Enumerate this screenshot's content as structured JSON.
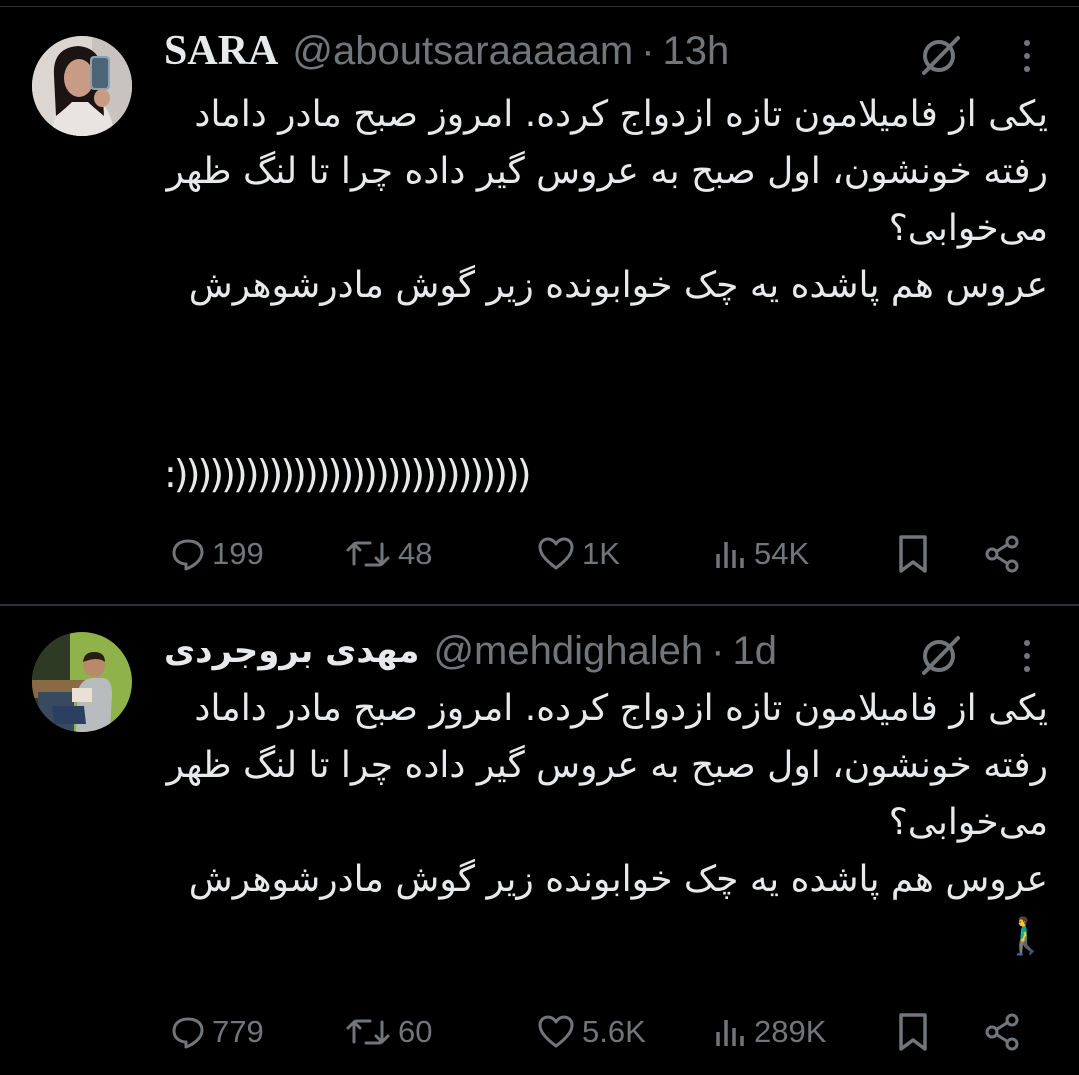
{
  "tweets": [
    {
      "name": "SARA",
      "handle": "@aboutsaraaaaam",
      "dot": "·",
      "time": "13h",
      "text": "یکی از فامیلامون تازه ازدواج کرده. امروز صبح مادر داماد رفته خونشون، اول صبح به عروس گیر داده چرا تا لنگ ظهر می‌خوابی؟\nعروس هم پاشده یه چک خوابونده زیر گوش مادرشوهرش",
      "extra": ":))))))))))))))))))))))))))))))",
      "stats": {
        "replies": "199",
        "reposts": "48",
        "likes": "1K",
        "views": "54K"
      }
    },
    {
      "name": "مهدی بروجردی",
      "handle": "@mehdighaleh",
      "dot": "·",
      "time": "1d",
      "text": "یکی از فامیلامون تازه ازدواج کرده. امروز صبح مادر داماد رفته خونشون، اول صبح به عروس گیر داده چرا تا لنگ ظهر می‌خوابی؟\nعروس هم پاشده یه چک خوابونده زیر گوش مادرشوهرش 🚶‍♂️",
      "stats": {
        "replies": "779",
        "reposts": "60",
        "likes": "5.6K",
        "views": "289K"
      }
    }
  ],
  "colors": {
    "background": "#000000",
    "text": "#e7e9ea",
    "muted": "#71767b",
    "divider": "#2f3336"
  },
  "icons": [
    "grok-icon",
    "more-icon",
    "reply-icon",
    "repost-icon",
    "like-icon",
    "views-icon",
    "bookmark-icon",
    "share-icon"
  ]
}
